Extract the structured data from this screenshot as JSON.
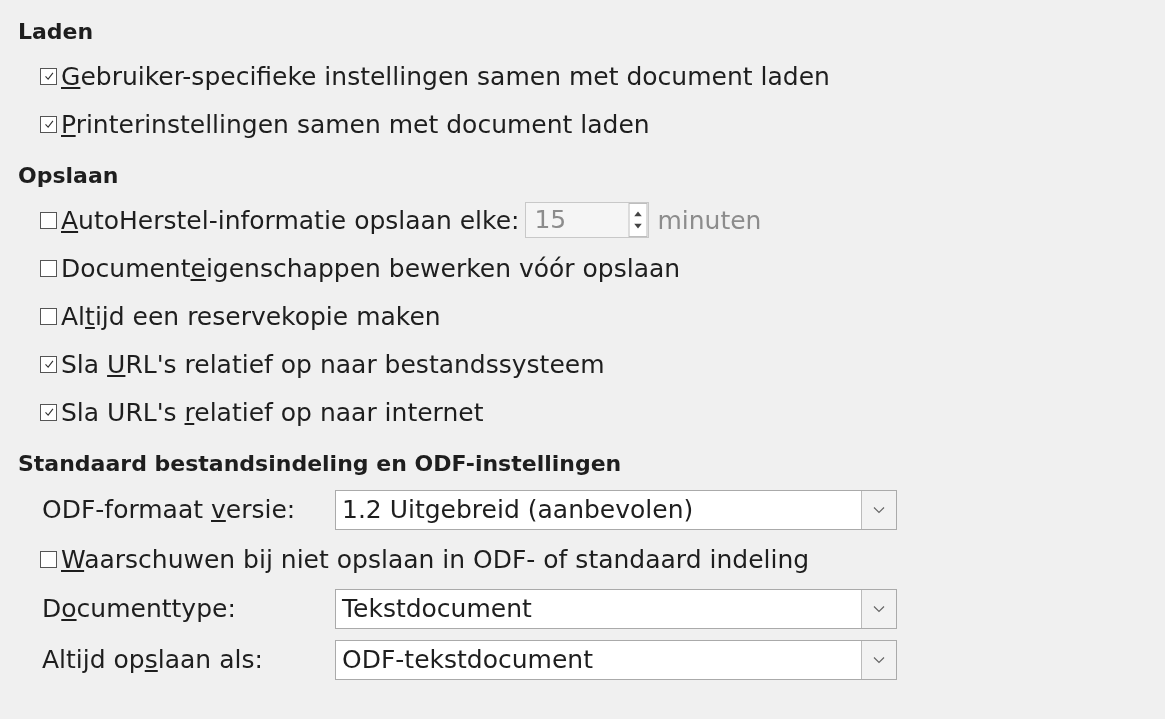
{
  "sections": [
    {
      "title": "Laden",
      "items": [
        {
          "kind": "checkbox",
          "checked": true,
          "access_key": "G",
          "label_end": "ebruiker-specifieke instellingen samen met document laden"
        },
        {
          "kind": "checkbox",
          "checked": true,
          "access_key": "P",
          "label_end": "rinterinstellingen samen met document laden"
        }
      ]
    },
    {
      "title": "Opslaan",
      "items": [
        {
          "kind": "spin",
          "checked": false,
          "access_key": "A",
          "label_end": "utoHerstel-informatie opslaan elke:",
          "value": "15",
          "unit": "minuten",
          "disabled": true
        },
        {
          "kind": "checkbox",
          "checked": false,
          "label_start": "Document",
          "access_key": "e",
          "label_end": "igenschappen bewerken vóór opslaan"
        },
        {
          "kind": "checkbox",
          "checked": false,
          "label_start": "Al",
          "access_key": "t",
          "label_end": "ijd een reservekopie maken"
        },
        {
          "kind": "checkbox",
          "checked": true,
          "label_start": "Sla ",
          "access_key": "U",
          "label_end": "RL's relatief op naar bestandssysteem"
        },
        {
          "kind": "checkbox",
          "checked": true,
          "label_start": "Sla URL's ",
          "access_key": "r",
          "label_end": "elatief op naar internet"
        }
      ]
    },
    {
      "title": "Standaard bestandsindeling en ODF-instellingen",
      "items": [
        {
          "kind": "select",
          "label_start": "ODF-formaat ",
          "access_key": "v",
          "label_end": "ersie:",
          "value": "1.2 Uitgebreid (aanbevolen)"
        },
        {
          "kind": "checkbox",
          "checked": false,
          "access_key": "W",
          "label_end": "aarschuwen bij niet opslaan in ODF- of standaard indeling"
        },
        {
          "kind": "select",
          "label_start": "D",
          "access_key": "o",
          "label_end": "cumenttype:",
          "value": "Tekstdocument"
        },
        {
          "kind": "select",
          "label_start": "Altijd op",
          "access_key": "s",
          "label_end": "laan als:",
          "value": "ODF-tekstdocument"
        }
      ]
    }
  ]
}
